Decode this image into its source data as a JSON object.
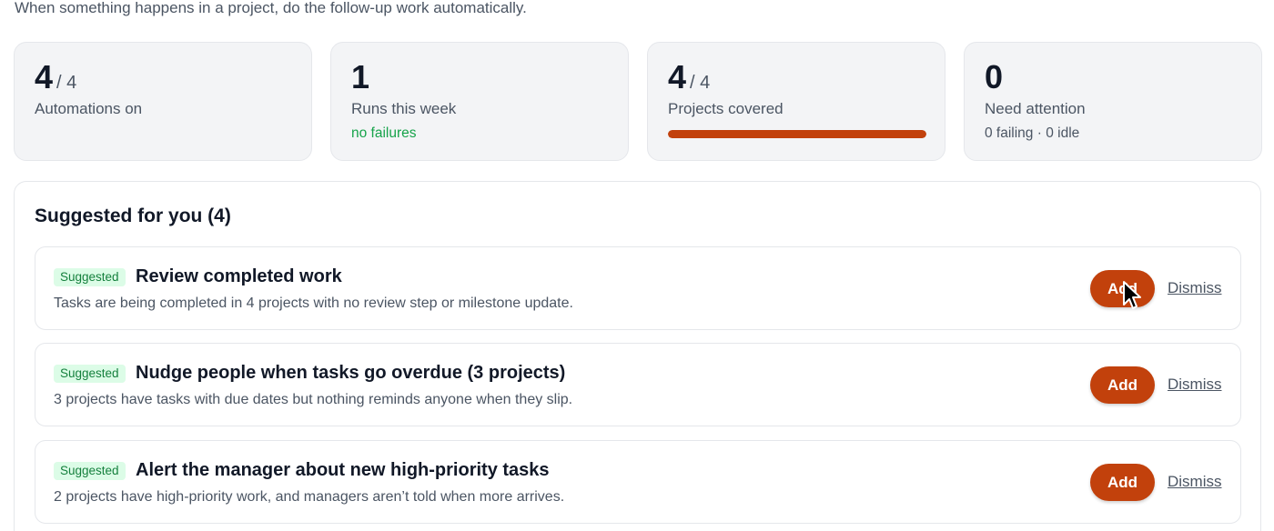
{
  "header": {
    "subtitle": "When something happens in a project, do the follow-up work automatically."
  },
  "stats": [
    {
      "value": "4",
      "total": "/ 4",
      "label": "Automations on",
      "sub": ""
    },
    {
      "value": "1",
      "total": "",
      "label": "Runs this week",
      "sub": "no failures"
    },
    {
      "value": "4",
      "total": "/ 4",
      "label": "Projects covered",
      "progress_percent": 100
    },
    {
      "value": "0",
      "total": "",
      "label": "Need attention",
      "sub": "0 failing · 0 idle"
    }
  ],
  "suggestions": {
    "title": "Suggested for you (4)",
    "items": [
      {
        "badge": "Suggested",
        "title": "Review completed work",
        "description": "Tasks are being completed in 4 projects with no review step or milestone update.",
        "add_label": "Add",
        "dismiss_label": "Dismiss"
      },
      {
        "badge": "Suggested",
        "title": "Nudge people when tasks go overdue (3 projects)",
        "description": "3 projects have tasks with due dates but nothing reminds anyone when they slip.",
        "add_label": "Add",
        "dismiss_label": "Dismiss"
      },
      {
        "badge": "Suggested",
        "title": "Alert the manager about new high-priority tasks",
        "description": "2 projects have high-priority work, and managers aren’t told when more arrives.",
        "add_label": "Add",
        "dismiss_label": "Dismiss"
      }
    ]
  },
  "colors": {
    "accent": "#c2410c",
    "success": "#16a34a",
    "badge_bg": "#dcfce7",
    "card_bg": "#f3f4f6"
  }
}
